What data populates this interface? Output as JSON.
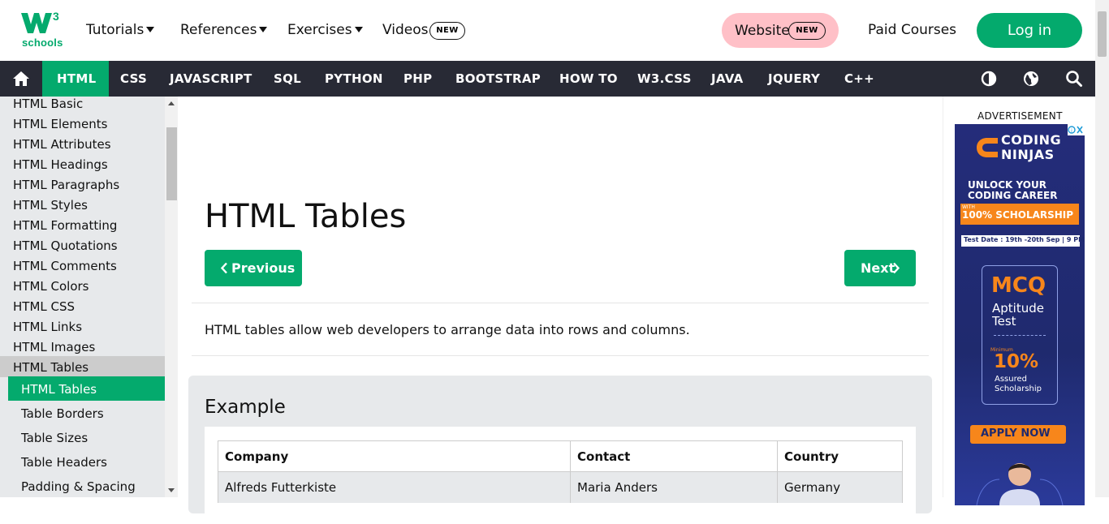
{
  "logo": {
    "superscript": "3",
    "text": "schools"
  },
  "topnav": {
    "tutorials": "Tutorials",
    "references": "References",
    "exercises": "Exercises",
    "videos": "Videos",
    "videos_badge": "NEW",
    "website": "Website",
    "website_badge": "NEW",
    "paid_courses": "Paid Courses",
    "login": "Log in"
  },
  "mainnav": {
    "items": [
      "HTML",
      "CSS",
      "JAVASCRIPT",
      "SQL",
      "PYTHON",
      "PHP",
      "BOOTSTRAP",
      "HOW TO",
      "W3.CSS",
      "JAVA",
      "JQUERY",
      "C++"
    ],
    "active": "HTML"
  },
  "sidebar": {
    "links": [
      "HTML Basic",
      "HTML Elements",
      "HTML Attributes",
      "HTML Headings",
      "HTML Paragraphs",
      "HTML Styles",
      "HTML Formatting",
      "HTML Quotations",
      "HTML Comments",
      "HTML Colors",
      "HTML CSS",
      "HTML Links",
      "HTML Images",
      "HTML Tables"
    ],
    "sub": [
      "HTML Tables",
      "Table Borders",
      "Table Sizes",
      "Table Headers",
      "Padding & Spacing"
    ]
  },
  "main": {
    "title": "HTML Tables",
    "prev": "Previous",
    "next": "Next",
    "intro": "HTML tables allow web developers to arrange data into rows and columns.",
    "example_heading": "Example",
    "table": {
      "headers": [
        "Company",
        "Contact",
        "Country"
      ],
      "rows": [
        [
          "Alfreds Futterkiste",
          "Maria Anders",
          "Germany"
        ]
      ]
    }
  },
  "ad": {
    "label": "ADVERTISEMENT",
    "brand1": "CODING",
    "brand2": "NINJAS",
    "unlock1": "UNLOCK YOUR",
    "unlock2": "CODING CAREER",
    "with": "WITH",
    "scholarship": "100% SCHOLARSHIP",
    "test_date": "Test Date : 19th -20th Sep | 9 PM",
    "mcq": "MCQ",
    "aptitude": "Aptitude",
    "test": "Test",
    "minimum": "Minimum",
    "percent": "10%",
    "assured": "Assured",
    "scholarship2": "Scholarship",
    "apply": "APPLY NOW"
  },
  "colors": {
    "brand_green": "#04AA6D",
    "nav_dark": "#282A35",
    "sidebar_bg": "#E7E9EB",
    "website_pink": "#FFC0C7"
  }
}
